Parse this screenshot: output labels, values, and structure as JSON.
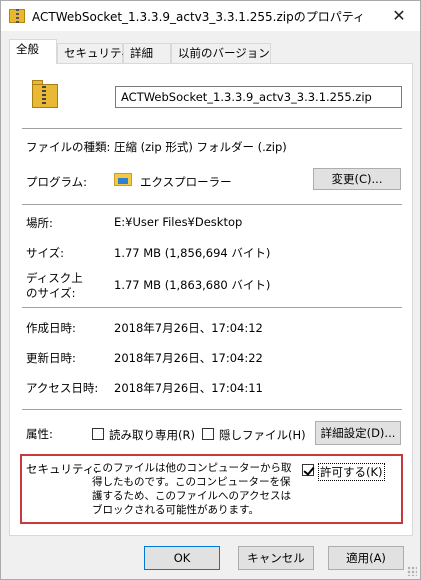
{
  "window": {
    "title": "ACTWebSocket_1.3.3.9_actv3_3.3.1.255.zipのプロパティ",
    "close_glyph": "✕"
  },
  "tabs": [
    {
      "label": "全般",
      "active": true
    },
    {
      "label": "セキュリティ",
      "active": false
    },
    {
      "label": "詳細",
      "active": false
    },
    {
      "label": "以前のバージョン",
      "active": false
    }
  ],
  "file": {
    "icon": "zip-folder-icon",
    "name": "ACTWebSocket_1.3.3.9_actv3_3.3.1.255.zip"
  },
  "properties": {
    "type_label": "ファイルの種類:",
    "type_value": "圧縮 (zip 形式) フォルダー (.zip)",
    "program_label": "プログラム:",
    "program_icon": "file-explorer-icon",
    "program_value": "エクスプローラー",
    "change_button": "変更(C)...",
    "location_label": "場所:",
    "location_value": "E:¥User Files¥Desktop",
    "size_label": "サイズ:",
    "size_value": "1.77 MB (1,856,694 バイト)",
    "disk_size_label_line1": "ディスク上",
    "disk_size_label_line2": "のサイズ:",
    "disk_size_value": "1.77 MB (1,863,680 バイト)",
    "created_label": "作成日時:",
    "created_value": "2018年7月26日、17:04:12",
    "modified_label": "更新日時:",
    "modified_value": "2018年7月26日、17:04:22",
    "accessed_label": "アクセス日時:",
    "accessed_value": "2018年7月26日、17:04:11"
  },
  "attributes": {
    "label": "属性:",
    "readonly_label": "読み取り専用(R)",
    "readonly_checked": false,
    "hidden_label": "隠しファイル(H)",
    "hidden_checked": false,
    "advanced_button": "詳細設定(D)..."
  },
  "security": {
    "label": "セキュリティ:",
    "message": "このファイルは他のコンピューターから取得したものです。このコンピューターを保護するため、このファイルへのアクセスはブロックされる可能性があります。",
    "unblock_label": "許可する(K)",
    "unblock_checked": true,
    "highlight_color": "#c8393b"
  },
  "footer": {
    "ok": "OK",
    "cancel": "キャンセル",
    "apply": "適用(A)"
  }
}
